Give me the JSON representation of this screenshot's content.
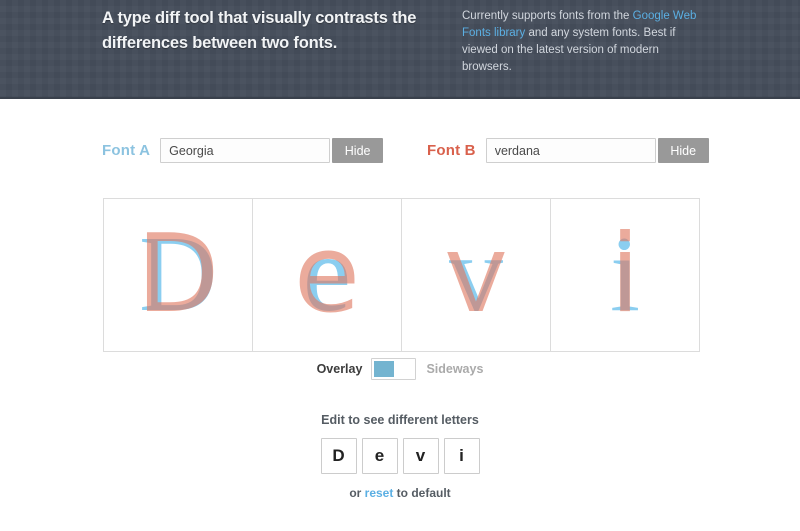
{
  "header": {
    "tagline": "A type diff tool that visually contrasts the differences between two fonts.",
    "blurb": {
      "before_link": "Currently supports fonts from the ",
      "link_text": "Google Web Fonts library",
      "after_link": " and any system fonts. Best if viewed on the latest version of modern browsers."
    },
    "background_color": "#434b58"
  },
  "fonts": {
    "a": {
      "label": "Font A",
      "value": "Georgia",
      "placeholder": "Font A",
      "hide_label": "Hide",
      "color": "#8cc3e0"
    },
    "b": {
      "label": "Font B",
      "value": "verdana",
      "placeholder": "Font B",
      "hide_label": "Hide",
      "color": "#d9614c"
    }
  },
  "preview": {
    "letters": [
      "D",
      "e",
      "v",
      "i"
    ]
  },
  "mode": {
    "overlay_label": "Overlay",
    "sideways_label": "Sideways",
    "selected": "Overlay",
    "knob_color": "#74b4d0"
  },
  "editor": {
    "hint": "Edit to see different letters",
    "letters": [
      "D",
      "e",
      "v",
      "i"
    ],
    "reset_prefix": "or ",
    "reset_link": "reset",
    "reset_suffix": " to default"
  }
}
